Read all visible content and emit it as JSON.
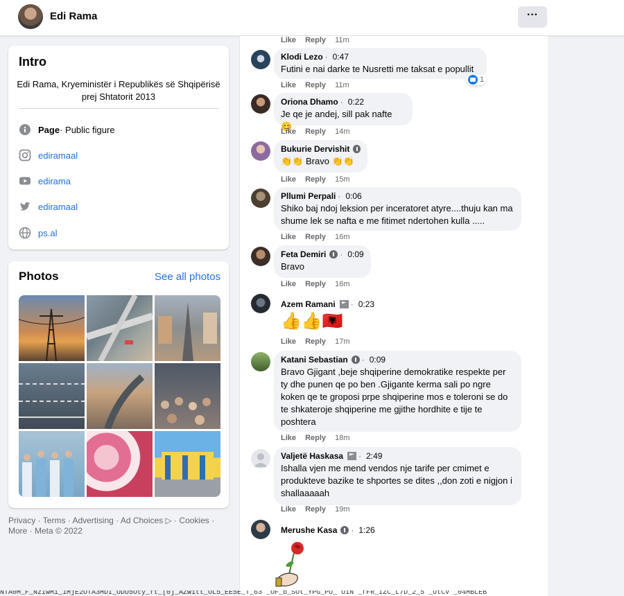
{
  "header": {
    "page_name": "Edi Rama",
    "more_label": "···"
  },
  "intro": {
    "title": "Intro",
    "bio": "Edi Rama, Kryeministër i Republikës së Shqipërisë prej Shtatorit 2013",
    "category_bold": "Page",
    "category_rest": " · Public figure",
    "instagram": "ediramaal",
    "youtube": "edirama",
    "twitter": "ediramaal",
    "website": "ps.al"
  },
  "photos": {
    "title": "Photos",
    "see_all": "See all photos"
  },
  "footer": {
    "text": "Privacy · Terms · Advertising · Ad Choices ▷ · Cookies · More · Meta © 2022"
  },
  "feed": {
    "like": "Like",
    "reply": "Reply",
    "top_time": "11m",
    "comments": [
      {
        "name": "Klodi Lezo",
        "duration": "0:47",
        "text": "Futini e nai darke te Nusretti me taksat e popullit",
        "time": "11m",
        "reactions": "1"
      },
      {
        "name": "Oriona Dhamo",
        "duration": "0:22",
        "text": "Je qe je andej, sill pak nafte 😊",
        "time": "14m"
      },
      {
        "name": "Bukurie Dervishit",
        "text": "👏👏 Bravo 👏👏",
        "time": "15m"
      },
      {
        "name": "Pllumi Perpali",
        "duration": "0:06",
        "text": "Shiko baj ndoj leksion per inceratoret atyre....thuju kan ma shume lek se nafta e me fitimet ndertohen kulla .....",
        "time": "16m"
      },
      {
        "name": "Feta Demiri",
        "duration": "0:09",
        "text": "Bravo",
        "time": "16m"
      },
      {
        "name": "Azem Ramani",
        "duration": "0:23",
        "text": "👍👍🇦🇱",
        "time": "17m"
      },
      {
        "name": "Katani Sebastian",
        "duration": "0:09",
        "text": "Bravo Gjigant ,beje shqiperine demokratike respekte per ty dhe punen qe po ben .Gjigante kerma sali po ngre koken qe te groposi prpe shqiperine mos e toleroni se do te shkateroje shqiperine me gjithe hordhite e tije te poshtera",
        "time": "18m"
      },
      {
        "name": "Valjetë Haskasa",
        "duration": "2:49",
        "text": "Ishalla vjen me mend vendos nje tarife per cmimet e produkteve bazike te shportes se dites ,,don zoti e nigjon i shallaaaaah",
        "time": "19m"
      },
      {
        "name": "Merushe Kasa",
        "duration": "1:26"
      }
    ]
  },
  "colors": {
    "link": "#216fdb",
    "bubble": "#f0f2f5",
    "muted": "#65676b",
    "like_blue": "#1877f2"
  },
  "bottom_strip": "NTA0M_F_NzIwMi_1MjE2OTA3MDI_ODU5Oty_ft_[0]_AZWitt_OL5_EE5E_T_63 _OF_b_SOt_YPG_PU_ UiN _fFR_IZC_L7D_2_5 _UtCV _04MBLEB"
}
